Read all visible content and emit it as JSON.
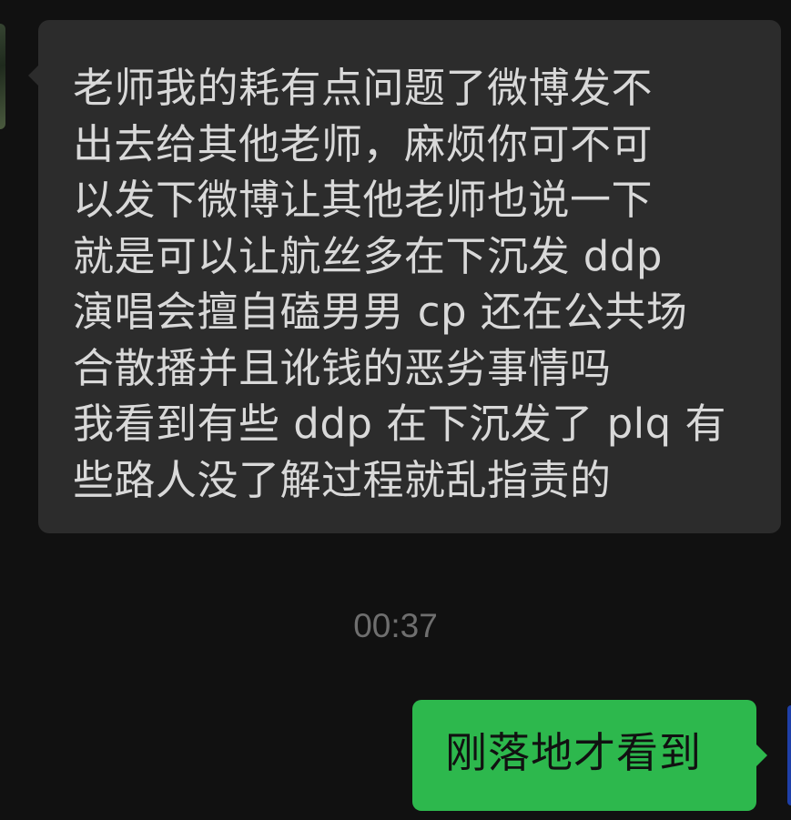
{
  "conversation": {
    "incoming_message": {
      "lines": [
        "老师我的耗有点问题了微博发不",
        "出去给其他老师，麻烦你可不可",
        "以发下微博让其他老师也说一下",
        "就是可以让航丝多在下沉发 ddp",
        "演唱会擅自磕男男 cp 还在公共场",
        "合散播并且讹钱的恶劣事情吗",
        "我看到有些 ddp 在下沉发了 plq 有",
        "些路人没了解过程就乱指责的"
      ]
    },
    "timestamp": "00:37",
    "outgoing_message": {
      "text": "刚落地才看到"
    }
  },
  "colors": {
    "background": "#111111",
    "incoming_bubble": "#2c2c2c",
    "outgoing_bubble": "#2db84d",
    "incoming_text": "#d9d9d9",
    "timestamp_text": "#6f6f6f"
  }
}
